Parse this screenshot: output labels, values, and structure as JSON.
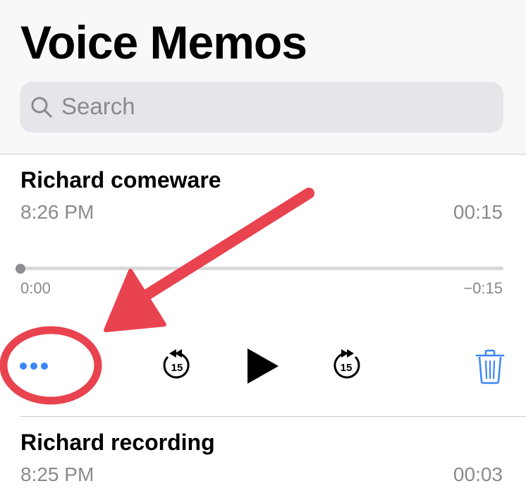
{
  "header": {
    "title": "Voice Memos",
    "search": {
      "placeholder": "Search",
      "icon": "search-icon"
    }
  },
  "memos": [
    {
      "title": "Richard comeware",
      "time": "8:26 PM",
      "duration": "00:15",
      "expanded": true,
      "player": {
        "elapsed": "0:00",
        "remaining": "−0:15",
        "progress": 0,
        "skip_back_seconds": "15",
        "skip_forward_seconds": "15"
      }
    },
    {
      "title": "Richard recording",
      "time": "8:25 PM",
      "duration": "00:03",
      "expanded": false
    }
  ],
  "colors": {
    "accent": "#3a86f5",
    "annotation_red": "#e8434f",
    "secondary_text": "#8a8a8e"
  },
  "icons": [
    "search-icon",
    "more-icon",
    "skip-back-15-icon",
    "play-icon",
    "skip-forward-15-icon",
    "trash-icon"
  ]
}
